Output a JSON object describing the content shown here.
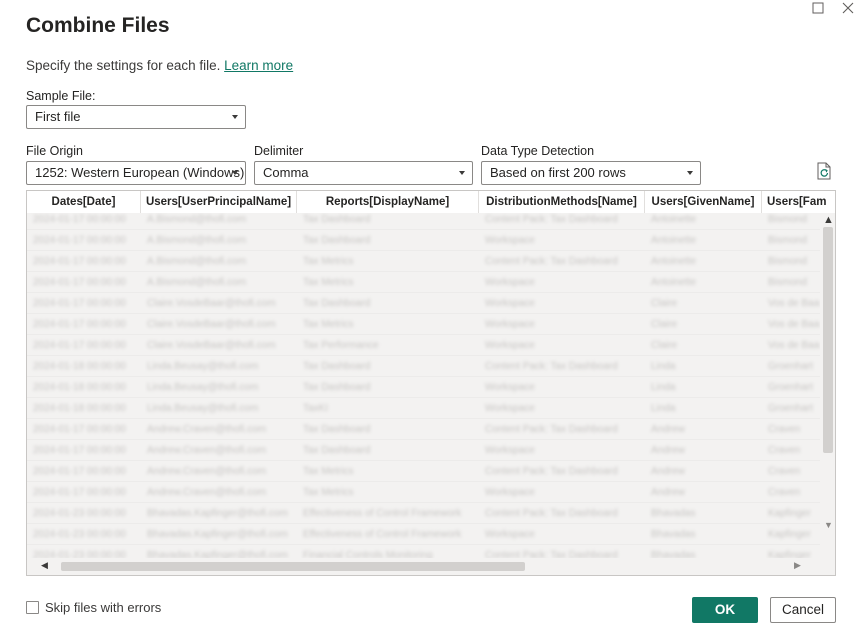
{
  "window": {
    "maximize_icon": "maximize-icon",
    "close_icon": "close-icon"
  },
  "dialog": {
    "title": "Combine Files",
    "subtitle": "Specify the settings for each file.",
    "learn_more": "Learn more"
  },
  "sample_file": {
    "label": "Sample File:",
    "value": "First file"
  },
  "file_origin": {
    "label": "File Origin",
    "value": "1252: Western European (Windows)"
  },
  "delimiter": {
    "label": "Delimiter",
    "value": "Comma"
  },
  "data_type_detection": {
    "label": "Data Type Detection",
    "value": "Based on first 200 rows"
  },
  "refresh_icon": "refresh-icon",
  "table": {
    "columns": [
      "Dates[Date]",
      "Users[UserPrincipalName]",
      "Reports[DisplayName]",
      "DistributionMethods[Name]",
      "Users[GivenName]",
      "Users[Fam"
    ],
    "rows": [
      [
        "2024-01-17 00:00:00",
        "A.Bismond@thofi.com",
        "Tax Dashboard",
        "Content Pack: Tax Dashboard",
        "Antoinette",
        "Bismond"
      ],
      [
        "2024-01-17 00:00:00",
        "A.Bismond@thofi.com",
        "Tax Dashboard",
        "Workspace",
        "Antoinette",
        "Bismond"
      ],
      [
        "2024-01-17 00:00:00",
        "A.Bismond@thofi.com",
        "Tax Metrics",
        "Content Pack: Tax Dashboard",
        "Antoinette",
        "Bismond"
      ],
      [
        "2024-01-17 00:00:00",
        "A.Bismond@thofi.com",
        "Tax Metrics",
        "Workspace",
        "Antoinette",
        "Bismond"
      ],
      [
        "2024-01-17 00:00:00",
        "Claire.VosdeBaar@thofi.com",
        "Tax Dashboard",
        "Workspace",
        "Claire",
        "Vos de Baar"
      ],
      [
        "2024-01-17 00:00:00",
        "Claire.VosdeBaar@thofi.com",
        "Tax Metrics",
        "Workspace",
        "Claire",
        "Vos de Baar"
      ],
      [
        "2024-01-17 00:00:00",
        "Claire.VosdeBaar@thofi.com",
        "Tax Performance",
        "Workspace",
        "Claire",
        "Vos de Baar"
      ],
      [
        "2024-01-18 00:00:00",
        "Linda.Beusay@thofi.com",
        "Tax Dashboard",
        "Content Pack: Tax Dashboard",
        "Linda",
        "Groenhart"
      ],
      [
        "2024-01-18 00:00:00",
        "Linda.Beusay@thofi.com",
        "Tax Dashboard",
        "Workspace",
        "Linda",
        "Groenhart"
      ],
      [
        "2024-01-18 00:00:00",
        "Linda.Beusay@thofi.com",
        "TaxKI",
        "Workspace",
        "Linda",
        "Groenhart"
      ],
      [
        "2024-01-17 00:00:00",
        "Andrew.Craven@thofi.com",
        "Tax Dashboard",
        "Content Pack: Tax Dashboard",
        "Andrew",
        "Craven"
      ],
      [
        "2024-01-17 00:00:00",
        "Andrew.Craven@thofi.com",
        "Tax Dashboard",
        "Workspace",
        "Andrew",
        "Craven"
      ],
      [
        "2024-01-17 00:00:00",
        "Andrew.Craven@thofi.com",
        "Tax Metrics",
        "Content Pack: Tax Dashboard",
        "Andrew",
        "Craven"
      ],
      [
        "2024-01-17 00:00:00",
        "Andrew.Craven@thofi.com",
        "Tax Metrics",
        "Workspace",
        "Andrew",
        "Craven"
      ],
      [
        "2024-01-23 00:00:00",
        "Bhavadas.Kapfinger@thofi.com",
        "Effectiveness of Control Framework",
        "Content Pack: Tax Dashboard",
        "Bhavadas",
        "Kapfinger"
      ],
      [
        "2024-01-23 00:00:00",
        "Bhavadas.Kapfinger@thofi.com",
        "Effectiveness of Control Framework",
        "Workspace",
        "Bhavadas",
        "Kapfinger"
      ],
      [
        "2024-01-23 00:00:00",
        "Bhavadas.Kapfinger@thofi.com",
        "Financial Controls Monitoring",
        "Content Pack: Tax Dashboard",
        "Bhavadas",
        "Kapfinger"
      ]
    ]
  },
  "skip_errors": {
    "label": "Skip files with errors",
    "checked": false
  },
  "buttons": {
    "ok": "OK",
    "cancel": "Cancel"
  }
}
